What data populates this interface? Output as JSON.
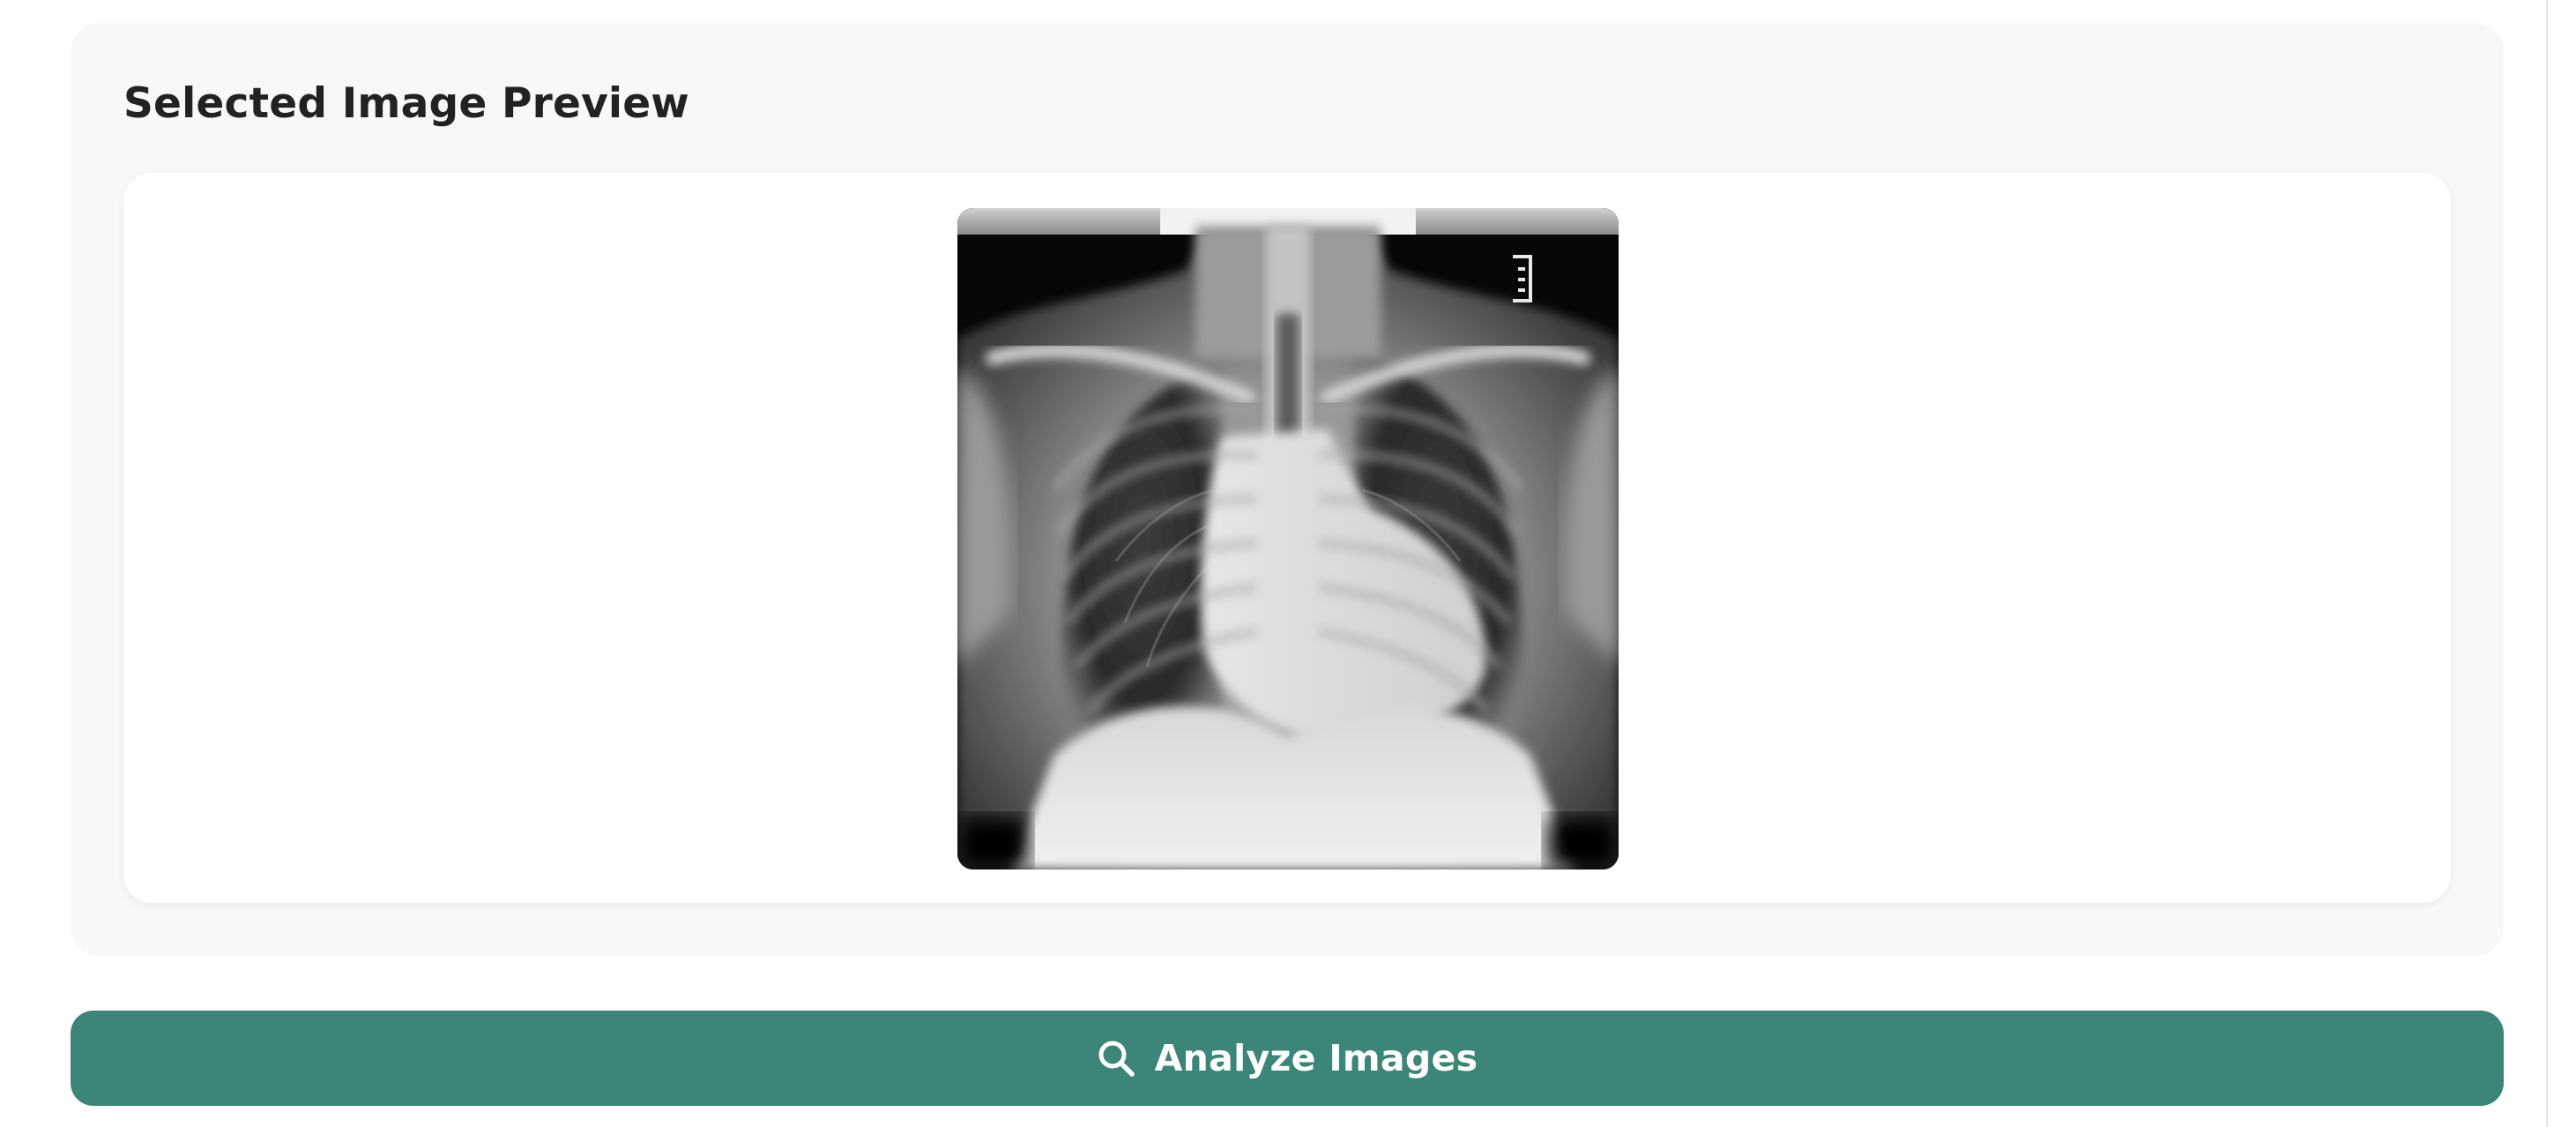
{
  "preview": {
    "title": "Selected Image Preview",
    "image_alt": "Chest X-ray image preview"
  },
  "analyze_button": {
    "label": "Analyze Images",
    "icon": "search-icon",
    "color": "#3c8579"
  },
  "colors": {
    "card_background": "#f8f8f8",
    "frame_background": "#ffffff",
    "title_text": "#222222"
  }
}
